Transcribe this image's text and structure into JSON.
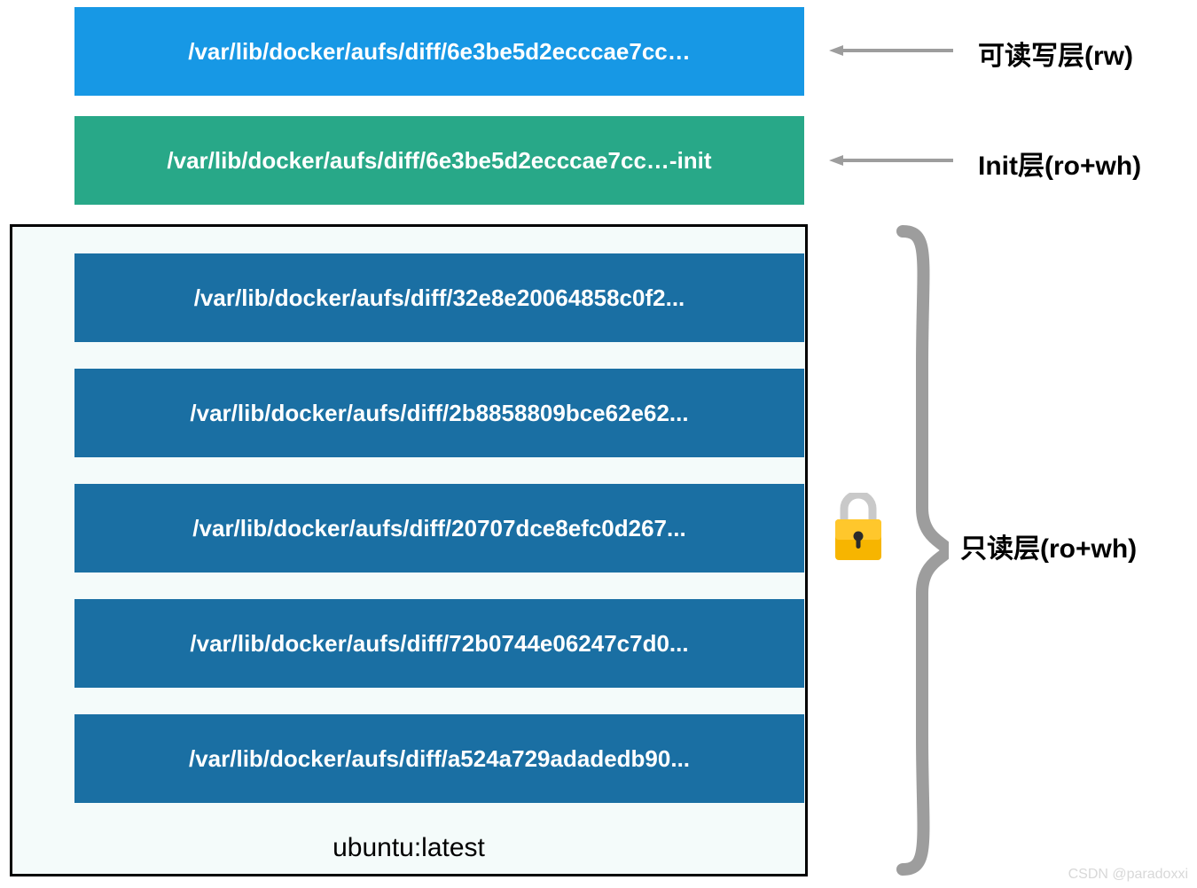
{
  "layers": {
    "rw": {
      "path": "/var/lib/docker/aufs/diff/6e3be5d2ecccae7cc…",
      "label": "可读写层(rw)"
    },
    "init": {
      "path": "/var/lib/docker/aufs/diff/6e3be5d2ecccae7cc…-init",
      "label": "Init层(ro+wh)"
    },
    "readonly": {
      "label": "只读层(ro+wh)",
      "image_tag": "ubuntu:latest",
      "items": [
        "/var/lib/docker/aufs/diff/32e8e20064858c0f2...",
        "/var/lib/docker/aufs/diff/2b8858809bce62e62...",
        "/var/lib/docker/aufs/diff/20707dce8efc0d267...",
        "/var/lib/docker/aufs/diff/72b0744e06247c7d0...",
        "/var/lib/docker/aufs/diff/a524a729adadedb90..."
      ]
    }
  },
  "colors": {
    "rw_bg": "#1798e5",
    "init_bg": "#28a888",
    "ro_bg": "#1a6fa3",
    "ro_container_bg": "#f4fbfa",
    "arrow": "#9d9d9d",
    "brace": "#9d9d9d"
  },
  "watermark": "CSDN @paradoxxi"
}
